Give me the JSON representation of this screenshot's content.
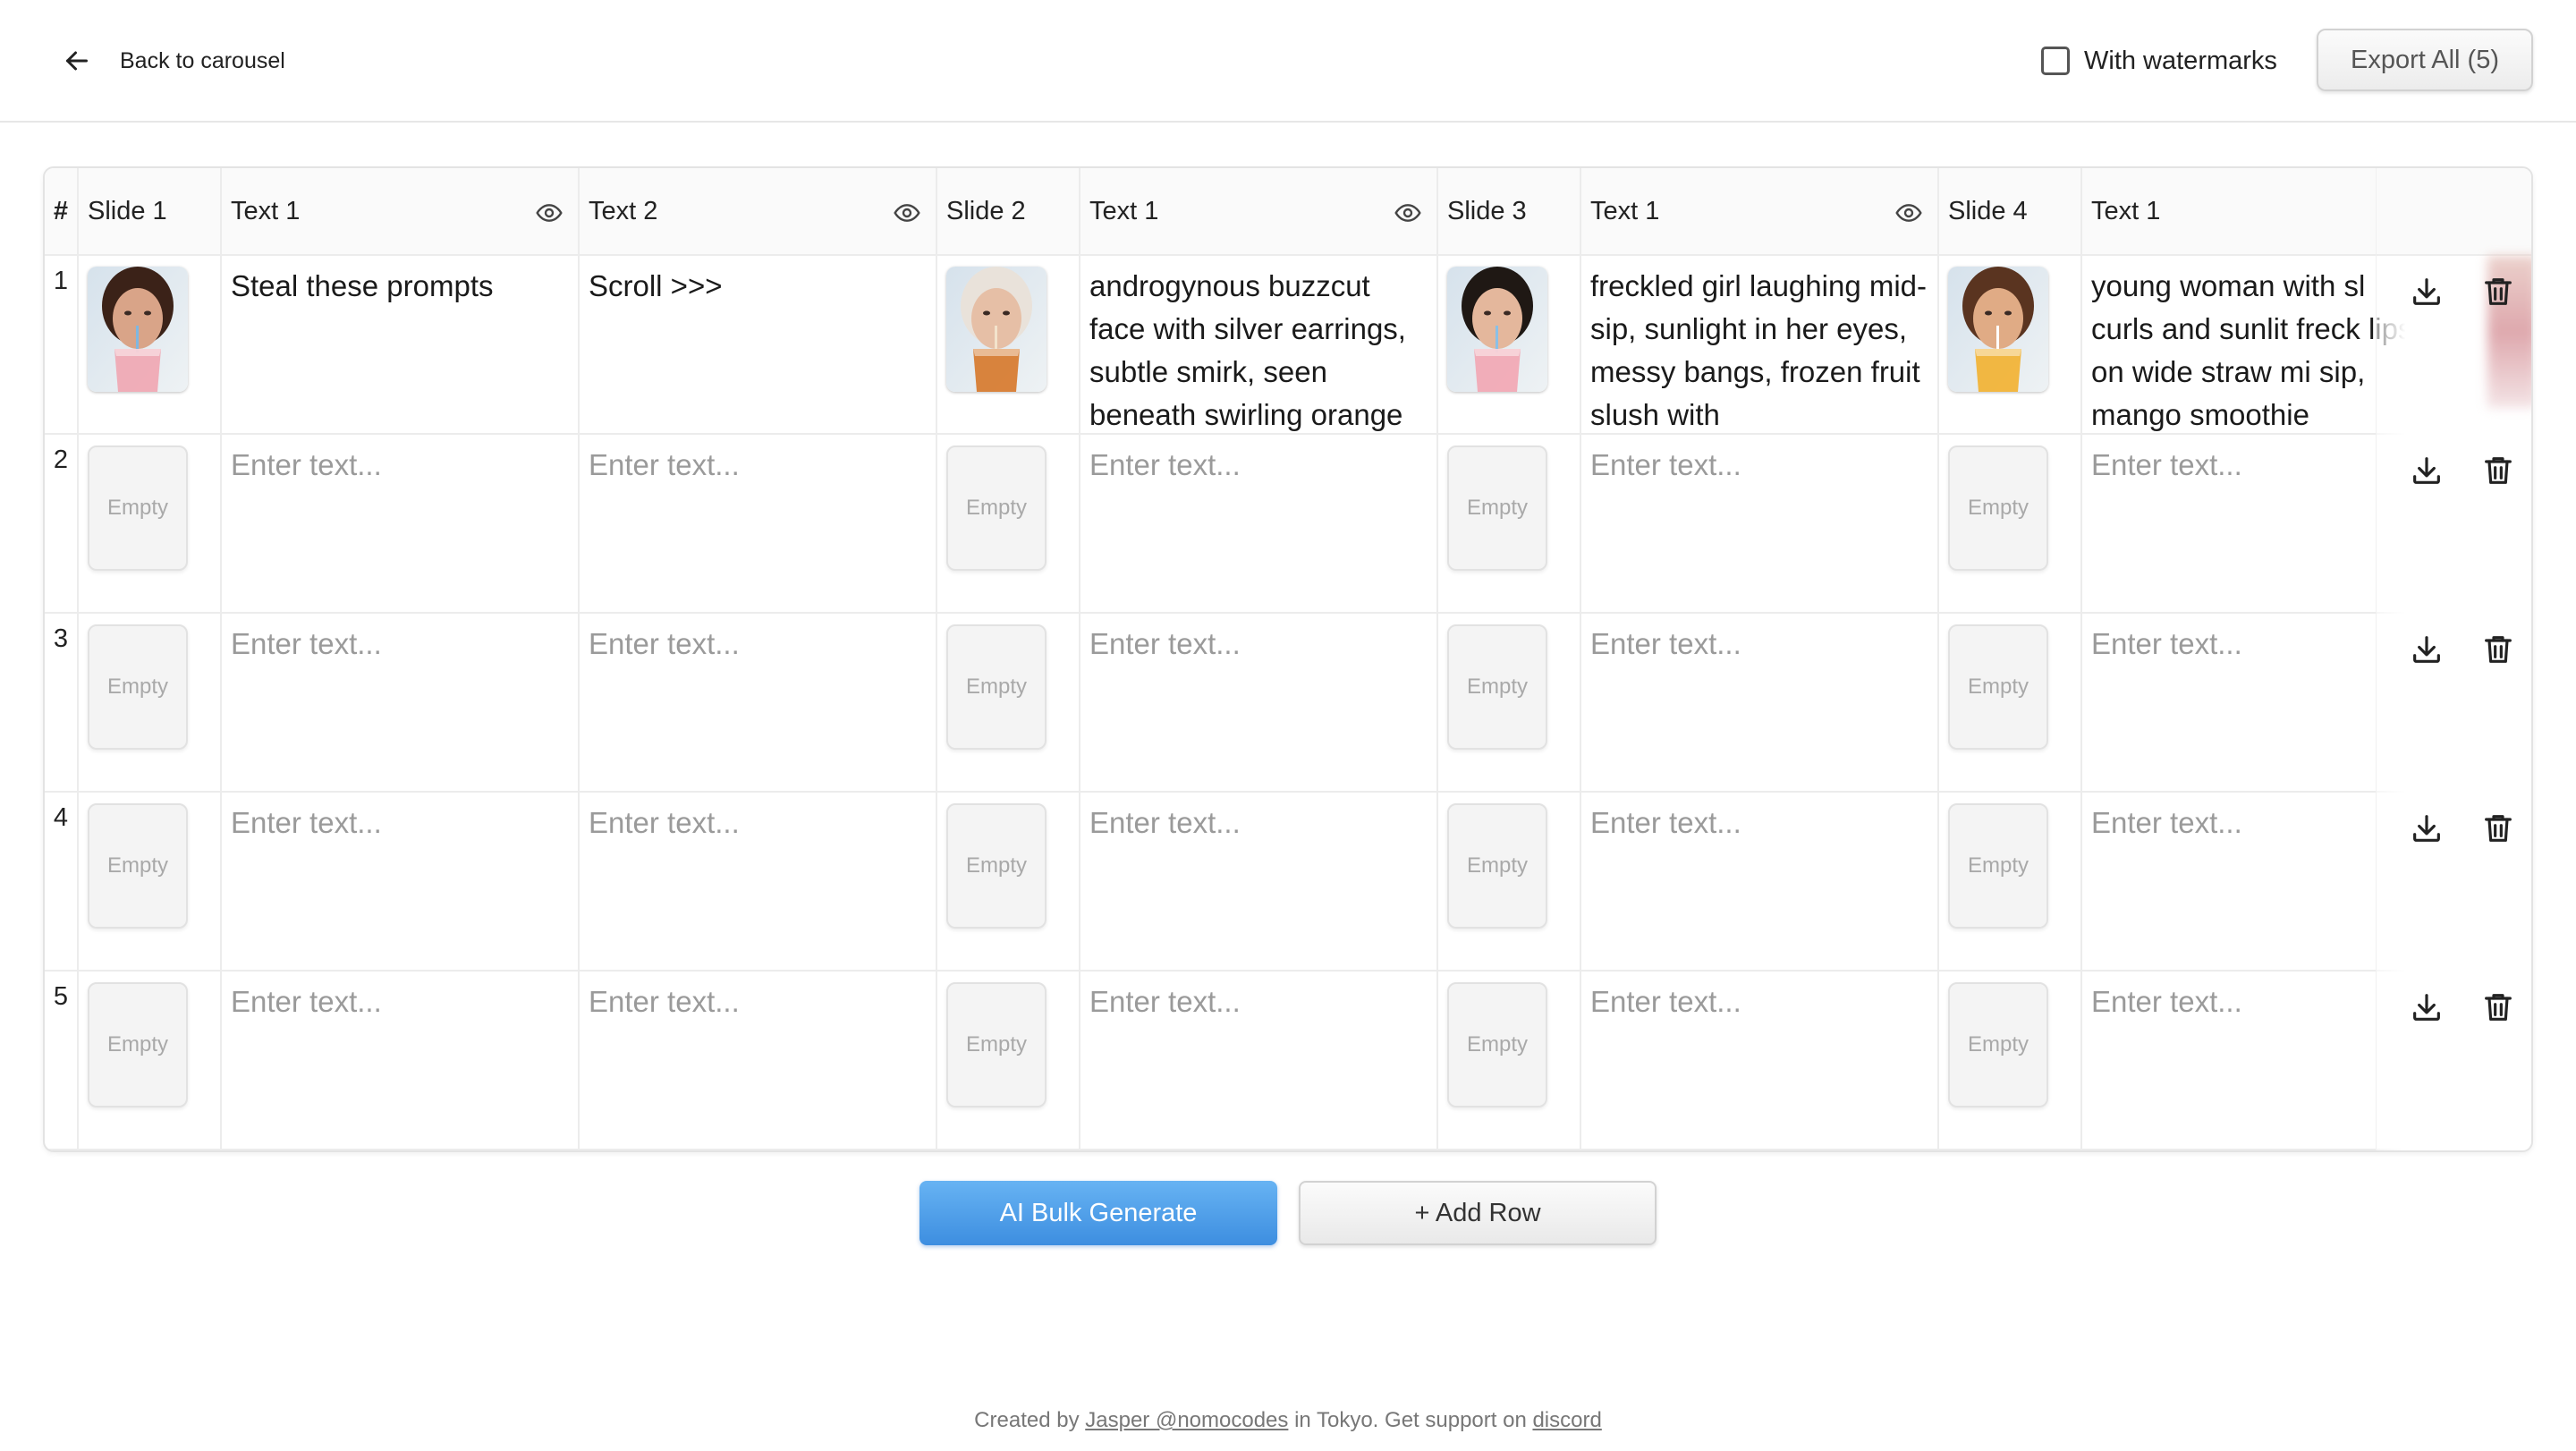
{
  "header": {
    "back_label": "Back to carousel",
    "watermark_label": "With watermarks",
    "watermark_checked": false,
    "export_label": "Export All (5)"
  },
  "table": {
    "hash": "#",
    "columns": [
      {
        "label": "Slide 1",
        "kind": "image"
      },
      {
        "label": "Text 1",
        "kind": "text",
        "visibility_icon": "eye-icon"
      },
      {
        "label": "Text 2",
        "kind": "text",
        "visibility_icon": "eye-icon"
      },
      {
        "label": "Slide 2",
        "kind": "image"
      },
      {
        "label": "Text 1",
        "kind": "text",
        "visibility_icon": "eye-icon"
      },
      {
        "label": "Slide 3",
        "kind": "image"
      },
      {
        "label": "Text 1",
        "kind": "text",
        "visibility_icon": "eye-icon"
      },
      {
        "label": "Slide 4",
        "kind": "image"
      },
      {
        "label": "Text 1",
        "kind": "text"
      }
    ],
    "empty_label": "Empty",
    "placeholder": "Enter text...",
    "rows": [
      {
        "num": "1",
        "cells": [
          {
            "image": "portrait-drinking-pink-smoothie"
          },
          {
            "text": "Steal these prompts"
          },
          {
            "text": "Scroll >>>"
          },
          {
            "image": "portrait-iced-tea-orange"
          },
          {
            "text": "androgynous buzzcut face with silver earrings, subtle smirk, seen beneath swirling orange"
          },
          {
            "image": "portrait-laughing-slush"
          },
          {
            "text": "freckled girl laughing mid-sip, sunlight in her eyes, messy bangs, frozen fruit slush with"
          },
          {
            "image": "portrait-mango-smoothie"
          },
          {
            "text": "young woman with sl curls and sunlit freck lips on wide straw mi sip, mango smoothie"
          }
        ]
      },
      {
        "num": "2",
        "cells": [
          {},
          {},
          {},
          {},
          {},
          {},
          {},
          {},
          {}
        ]
      },
      {
        "num": "3",
        "cells": [
          {},
          {},
          {},
          {},
          {},
          {},
          {},
          {},
          {}
        ]
      },
      {
        "num": "4",
        "cells": [
          {},
          {},
          {},
          {},
          {},
          {},
          {},
          {},
          {}
        ]
      },
      {
        "num": "5",
        "cells": [
          {},
          {},
          {},
          {},
          {},
          {},
          {},
          {},
          {}
        ]
      }
    ],
    "row_actions": [
      "download-icon",
      "trash-icon"
    ]
  },
  "actions": {
    "bulk_label": "AI Bulk Generate",
    "add_row_label": "+ Add Row"
  },
  "footer": {
    "prefix": "Created by ",
    "author": "Jasper @nomocodes",
    "middle": " in Tokyo. Get support on ",
    "support": "discord"
  },
  "colors": {
    "accent": "#3d8ee0",
    "border": "#ececec",
    "placeholder": "#9a9a9a"
  }
}
